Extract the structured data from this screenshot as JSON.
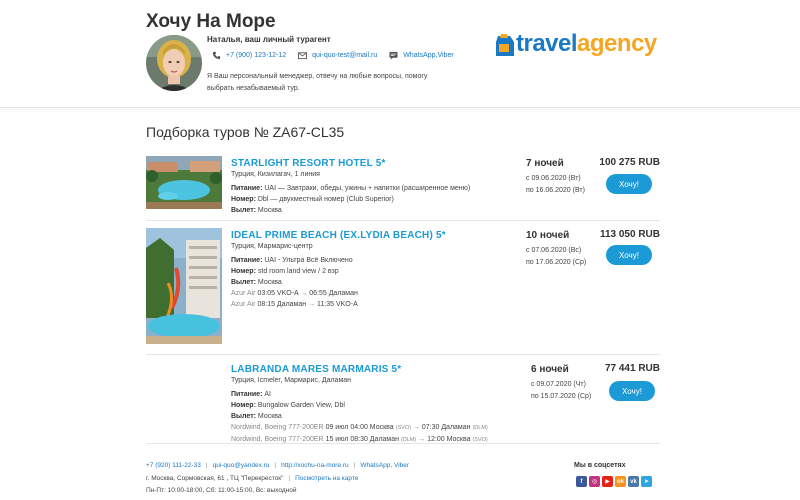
{
  "agency": {
    "title": "Хочу На Море",
    "agent_name": "Наталья, ваш личный турагент",
    "phone": "+7 (900) 123-12-12",
    "email": "qui-quo-test@mail.ru",
    "messengers": "WhatsApp,Viber",
    "about": "Я Ваш персональный менеджер, отвечу на любые вопросы, помогу выбрать незабываемый тур.",
    "logo_part1": "travel",
    "logo_part2": "agency"
  },
  "selection_title": "Подборка туров № ZA67-CL35",
  "tours": [
    {
      "hotel": "STARLIGHT RESORT HOTEL 5*",
      "location": "Турция, Кизилагач, 1 линия",
      "meal_label": "Питание:",
      "meal": "UAI — Завтраки, обеды, ужины + напитки (расширенное меню)",
      "room_label": "Номер:",
      "room": "Dbl — двухместный номер (Club Superior)",
      "departure_label": "Вылет:",
      "departure": "Москва",
      "nights": "7 ночей",
      "date_from": "с 09.06.2020 (Вт)",
      "date_to": "по 16.06.2020 (Вт)",
      "price": "100 275 RUB",
      "button": "Хочу!"
    },
    {
      "hotel": "IDEAL PRIME BEACH (EX.LYDIA BEACH) 5*",
      "location": "Турция, Мармарис-центр",
      "meal_label": "Питание:",
      "meal": "UAI - Ультра Всё Включено",
      "room_label": "Номер:",
      "room": "std room land view / 2 взр",
      "departure_label": "Вылет:",
      "departure": "Москва",
      "flights": [
        {
          "carrier": "Azur Air",
          "time1": "03:05 VKO-A",
          "arrow": "→",
          "time2": "06:55 Даламан"
        },
        {
          "carrier": "Azur Air",
          "time1": "08:15 Даламан",
          "arrow": "→",
          "time2": "11:35 VKO-A"
        }
      ],
      "nights": "10 ночей",
      "date_from": "с 07.06.2020 (Вс)",
      "date_to": "по 17.06.2020 (Ср)",
      "price": "113 050 RUB",
      "button": "Хочу!"
    },
    {
      "hotel": "LABRANDA MARES MARMARIS 5*",
      "location": "Турция, Icmeler, Мармарис, Даламан",
      "meal_label": "Питание:",
      "meal": "AI",
      "room_label": "Номер:",
      "room": "Bungalow Garden View, Dbl",
      "departure_label": "Вылет:",
      "departure": "Москва",
      "flights": [
        {
          "carrier": "Nordwind, Boeing 777-200ER",
          "dep": "09 июл 04:00 Москва",
          "code1": "(SVO)",
          "arrow": "→",
          "arr": "07:30 Даламан",
          "code2": "(DLM)"
        },
        {
          "carrier": "Nordwind, Boeing 777-200ER",
          "dep": "15 июл 08:30 Даламан",
          "code1": "(DLM)",
          "arrow": "→",
          "arr": "12:00 Москва",
          "code2": "(SVO)"
        }
      ],
      "nights": "6 ночей",
      "date_from": "с 09.07.2020 (Чт)",
      "date_to": "по 15.07.2020 (Ср)",
      "price": "77 441 RUB",
      "button": "Хочу!"
    }
  ],
  "footer": {
    "phone": "+7 (920) 111-22-33",
    "email": "qui-quo@yandex.ru",
    "site": "http://xochu-na-more.ru",
    "messengers": "WhatsApp, Viber",
    "address": "г. Москва, Сормовская, 61 , ТЦ \"Перекресток\"",
    "map_link": "Посмотреть на карте",
    "hours": "Пн-Пт: 10:00-18:00, Сб: 11:00-15:00, Вс: выходной",
    "social_title": "Мы в соцсетях",
    "social_icons": [
      "facebook-icon",
      "instagram-icon",
      "youtube-icon",
      "odnoklassniki-icon",
      "vk-icon",
      "telegram-icon"
    ]
  },
  "colors": {
    "accent": "#1b9ad6",
    "link": "#1b78c4",
    "logo_orange": "#f5a623"
  }
}
